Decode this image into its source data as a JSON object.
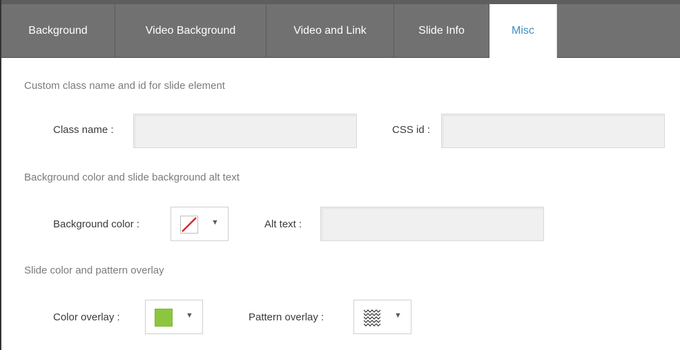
{
  "tabs": [
    {
      "label": "Background",
      "active": false
    },
    {
      "label": "Video Background",
      "active": false
    },
    {
      "label": "Video and Link",
      "active": false
    },
    {
      "label": "Slide Info",
      "active": false
    },
    {
      "label": "Misc",
      "active": true
    }
  ],
  "sections": {
    "custom": {
      "title": "Custom class name and id for slide element",
      "class_label": "Class name :",
      "class_value": "",
      "css_id_label": "CSS id :",
      "css_id_value": ""
    },
    "background": {
      "title": "Background color and slide background alt text",
      "color_label": "Background color :",
      "color_state": "none",
      "alt_label": "Alt text :",
      "alt_value": ""
    },
    "overlay": {
      "title": "Slide color and pattern overlay",
      "color_label": "Color overlay :",
      "color_value": "#8cc63f",
      "pattern_label": "Pattern overlay :",
      "pattern_icon": "zigzag-pattern-icon"
    }
  },
  "icons": {
    "caret": "▼"
  },
  "colors": {
    "tab_bar": "#717171",
    "active_tab_text": "#3d8fc6",
    "no_color_slash": "#d9262c"
  }
}
